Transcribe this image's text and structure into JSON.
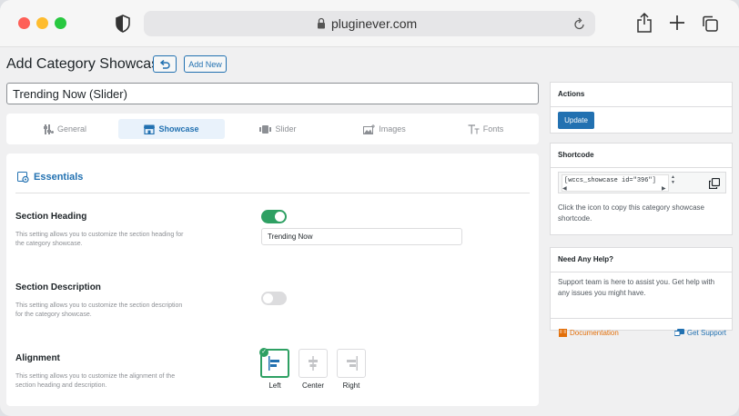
{
  "browser": {
    "url": "pluginever.com",
    "colors": {
      "close": "#fe5f57",
      "minimize": "#febc2e",
      "maximize": "#28c840"
    }
  },
  "page": {
    "title": "Add Category Showcase",
    "add_new_label": "Add New",
    "showcase_name": "Trending Now (Slider)"
  },
  "tabs": [
    {
      "label": "General",
      "icon": "settings-sliders-icon",
      "active": false
    },
    {
      "label": "Showcase",
      "icon": "store-icon",
      "active": true
    },
    {
      "label": "Slider",
      "icon": "slider-icon",
      "active": false
    },
    {
      "label": "Images",
      "icon": "images-icon",
      "active": false
    },
    {
      "label": "Fonts",
      "icon": "fonts-icon",
      "active": false
    }
  ],
  "essentials": {
    "title": "Essentials",
    "section_heading": {
      "label": "Section Heading",
      "description": "This setting allows you to customize the section heading for the category showcase.",
      "enabled": true,
      "value": "Trending Now"
    },
    "section_description": {
      "label": "Section Description",
      "description": "This setting allows you to customize the section description for the category showcase.",
      "enabled": false
    },
    "alignment": {
      "label": "Alignment",
      "description": "This setting allows you to customize the alignment of the section heading and description.",
      "options": [
        "Left",
        "Center",
        "Right"
      ],
      "selected": "Left"
    }
  },
  "sidebar": {
    "actions": {
      "title": "Actions",
      "update_label": "Update"
    },
    "shortcode": {
      "title": "Shortcode",
      "code": "[wccs_showcase id=\"396\"]",
      "help": "Click the icon to copy this category showcase shortcode."
    },
    "help": {
      "title": "Need Any Help?",
      "text": "Support team is here to assist you. Get help with any issues you might have.",
      "doc_label": "Documentation",
      "support_label": "Get Support"
    }
  },
  "colors": {
    "accent": "#2271b1",
    "toggle_on": "#2ea063",
    "doc_link": "#e26f0a"
  }
}
